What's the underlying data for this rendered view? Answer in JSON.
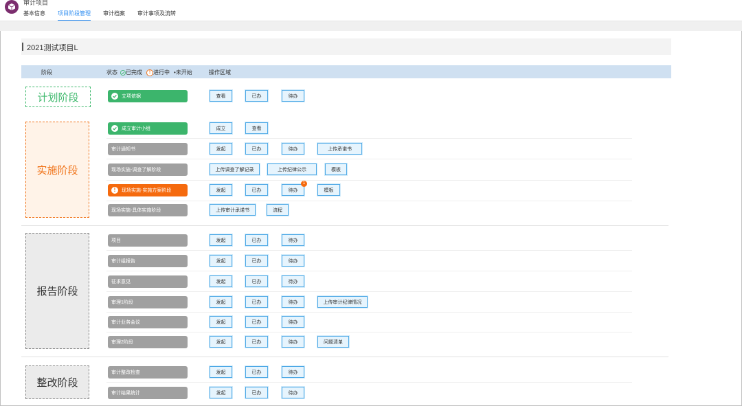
{
  "app": {
    "title": "审计项目"
  },
  "tabs": [
    "基本信息",
    "项目阶段管理",
    "审计档案",
    "审计事项及流转"
  ],
  "project": {
    "title": "2021测试项目L"
  },
  "table_header": {
    "stage": "阶段",
    "status": "状态",
    "done": "已完成",
    "in_progress": "进行中",
    "not_started": "未开始",
    "ops": "操作区域"
  },
  "stages": {
    "plan": "计划阶段",
    "impl": "实施阶段",
    "report": "报告阶段",
    "fix": "整改阶段"
  },
  "tasks": [
    {
      "label": "立项依据",
      "status": "done"
    },
    {
      "label": "成立审计小组",
      "status": "done"
    },
    {
      "label": "审计通知书",
      "status": "pending"
    },
    {
      "label": "现场实施-调查了解阶段",
      "status": "pending"
    },
    {
      "label": "现场实施-实施方案阶段",
      "status": "active"
    },
    {
      "label": "现场实施-具体实施阶段",
      "status": "pending"
    },
    {
      "label": "项目",
      "status": "pending"
    },
    {
      "label": "审计组报告",
      "status": "pending"
    },
    {
      "label": "征求意见",
      "status": "pending"
    },
    {
      "label": "审理1阶段",
      "status": "pending"
    },
    {
      "label": "审计业务会议",
      "status": "pending"
    },
    {
      "label": "审理2阶段",
      "status": "pending"
    },
    {
      "label": "审计整改检查",
      "status": "pending"
    },
    {
      "label": "审计结果统计",
      "status": "pending"
    }
  ],
  "buttons": {
    "view": "查看",
    "done": "已办",
    "todo": "待办",
    "establish": "成立",
    "initiate": "发起",
    "upload_commitment": "上传承诺书",
    "upload_survey": "上传调查了解记录",
    "upload_discipline_notice": "上传纪律公示",
    "template": "模板",
    "upload_audit_commitment": "上传审计承诺书",
    "process": "流程",
    "upload_discipline_status": "上传审计纪律情况",
    "issue_list": "问题清单"
  },
  "badge": {
    "count": "1"
  },
  "colors": {
    "done": "#3cb56c",
    "active": "#f56a0e",
    "pending": "#a0a0a0",
    "accent": "#2d8cf0"
  }
}
